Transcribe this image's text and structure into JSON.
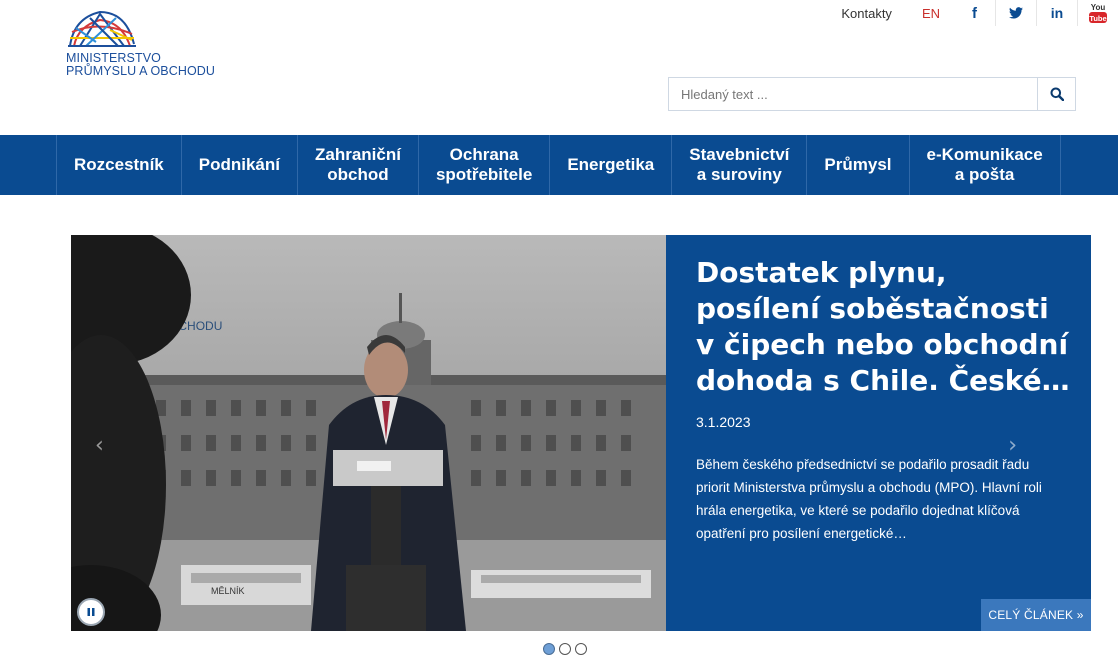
{
  "logo": {
    "line1": "MINISTERSTVO",
    "line2": "PRŮMYSLU A OBCHODU"
  },
  "topbar": {
    "contacts": "Kontakty",
    "lang": "EN",
    "social": [
      {
        "name": "facebook-icon",
        "glyph": "f"
      },
      {
        "name": "twitter-icon",
        "glyph": "t"
      },
      {
        "name": "linkedin-icon",
        "glyph": "in"
      },
      {
        "name": "youtube-icon",
        "glyph": "You Tube"
      }
    ]
  },
  "search": {
    "placeholder": "Hledaný text ..."
  },
  "nav": {
    "items": [
      {
        "line1": "Rozcestník",
        "line2": ""
      },
      {
        "line1": "Podnikání",
        "line2": ""
      },
      {
        "line1": "Zahraniční",
        "line2": "obchod"
      },
      {
        "line1": "Ochrana",
        "line2": "spotřebitele"
      },
      {
        "line1": "Energetika",
        "line2": ""
      },
      {
        "line1": "Stavebnictví",
        "line2": "a suroviny"
      },
      {
        "line1": "Průmysl",
        "line2": ""
      },
      {
        "line1": "e-Komunikace",
        "line2": "a pošta"
      }
    ]
  },
  "slide": {
    "image_caption": "PRŮMYSLU A OBCHODU",
    "sign_text": "MĚLNÍK",
    "title": "Dostatek plynu, posílení soběstačnosti v čipech nebo obchodní dohoda s Chile. České…",
    "date": "3.1.2023",
    "text": "Během českého předsednictví se podařilo prosadit řadu priorit Ministerstva průmyslu a obchodu (MPO). Hlavní roli hrála energetika, ve které se podařilo dojednat klíčová opatření pro posílení energetické…",
    "more": "CELÝ ČLÁNEK »",
    "prev_arrow": "‹",
    "next_arrow": "›"
  },
  "colors": {
    "brand": "#0a4b91",
    "accent": "#3b78bd",
    "lang": "#c9302c"
  }
}
